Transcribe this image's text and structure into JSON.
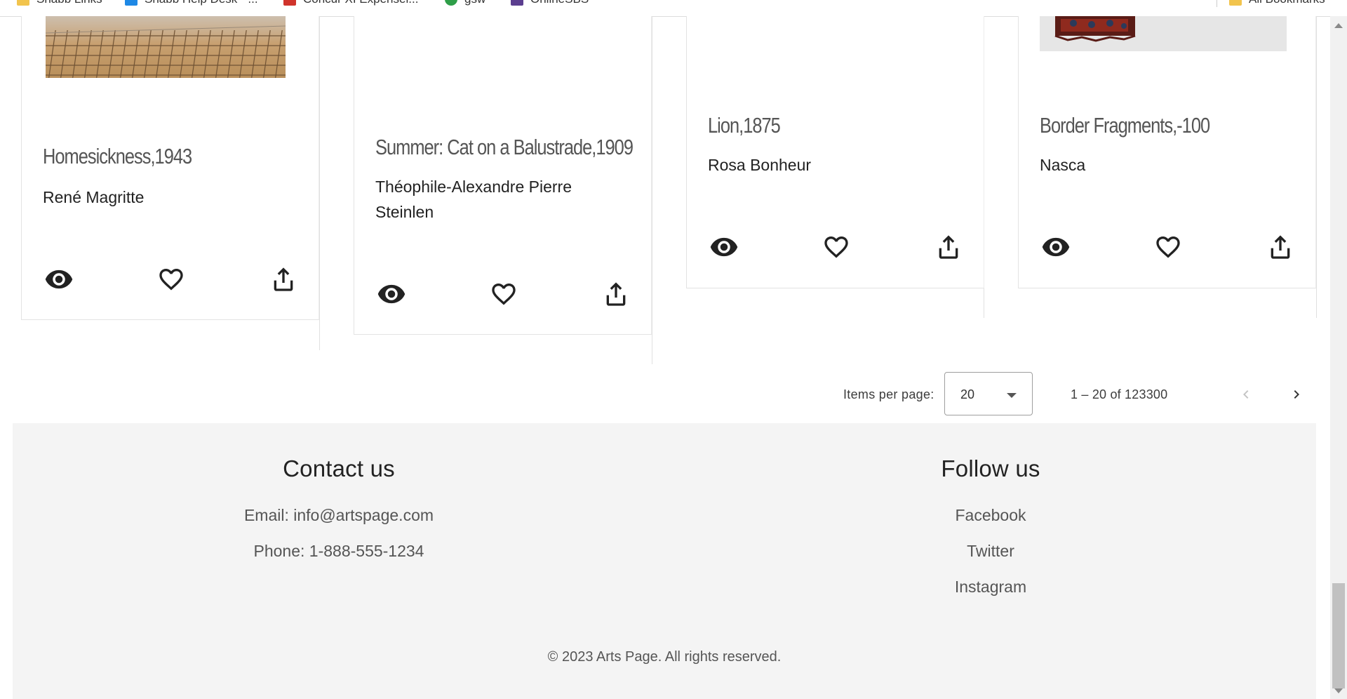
{
  "bookmarks": [
    {
      "label": "Shabb Links",
      "icon": "folder-icon",
      "color": "#f2c44d"
    },
    {
      "label": "Shabb Help Desk - ...",
      "icon": "windows-icon",
      "color": "#1e88e5"
    },
    {
      "label": "Concur XI Expensel...",
      "icon": "concur-icon",
      "color": "#d0342c"
    },
    {
      "label": "gsw",
      "icon": "green-circle-icon",
      "color": "#2e9e48"
    },
    {
      "label": "OnlineSBS",
      "icon": "onlinesbs-icon",
      "color": "#5b3e8f"
    },
    {
      "label": "All Bookmarks",
      "icon": "folder-icon",
      "color": "#f2c44d"
    }
  ],
  "cards": [
    {
      "title": "Homesickness,1943",
      "artist": "René Magritte"
    },
    {
      "title": "Summer: Cat on a Balustrade,1909",
      "artist": "Théophile-Alexandre Pierre Steinlen"
    },
    {
      "title": "Lion,1875",
      "artist": "Rosa Bonheur"
    },
    {
      "title": "Border Fragments,-100",
      "artist": "Nasca"
    }
  ],
  "card_action_icons": [
    "eye-icon",
    "heart-icon",
    "share-upload-icon"
  ],
  "paginator": {
    "items_per_page_label": "Items per page:",
    "page_size": "20",
    "range_label": "1 – 20 of 123300"
  },
  "footer": {
    "contact": {
      "heading": "Contact us",
      "email": "Email: info@artspage.com",
      "phone": "Phone: 1-888-555-1234"
    },
    "follow": {
      "heading": "Follow us",
      "links": [
        "Facebook",
        "Twitter",
        "Instagram"
      ]
    },
    "copyright": "© 2023 Arts Page. All rights reserved."
  },
  "colors": {
    "footer_bg": "#f4f4f4",
    "icon": "#222222",
    "title_text": "#555555"
  }
}
